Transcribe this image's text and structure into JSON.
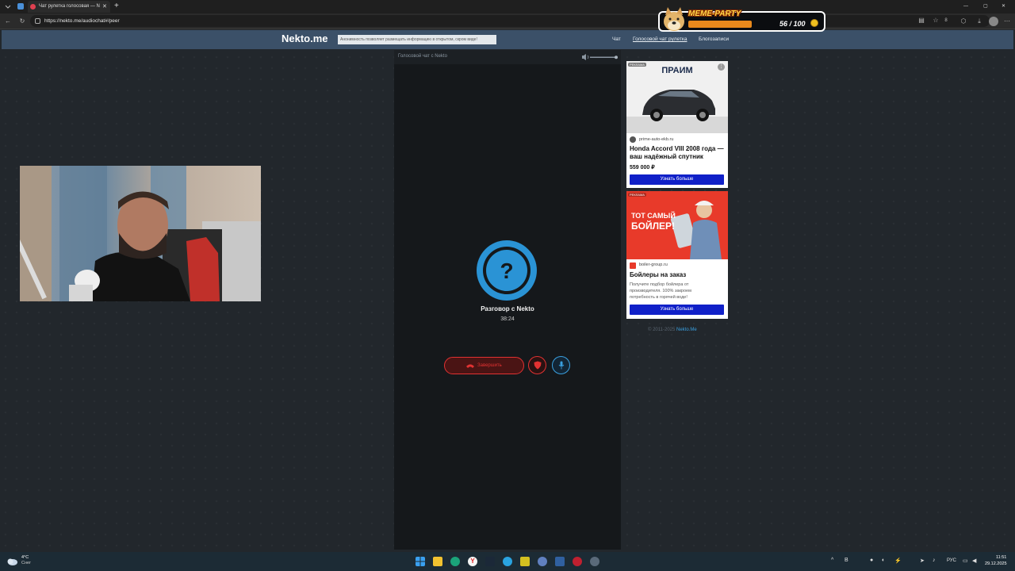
{
  "browser": {
    "tab_title": "Чат рулетка голосовая — N",
    "new_tab_glyph": "+",
    "url": "https://nekto.me/audiochat#/peer",
    "tab_count_badge": "8"
  },
  "site": {
    "logo": "Nekto.me",
    "notice": "Анонимность позволяет размещать информацию в открытом, скром виде!",
    "nav": {
      "chat": "Чат",
      "voice": "Голосовой чат рулетка",
      "blog": "Блогозаписи"
    }
  },
  "chat": {
    "header": "Голосовой чат с Nekto",
    "avatar_glyph": "?",
    "conversation": "Разговор с Nekto",
    "timer": "38:24",
    "end_button": "Завершить",
    "volume_level": 1.0
  },
  "ads": [
    {
      "badge": "РЕКЛАМА",
      "brand": "ПРАИМ",
      "domain": "prime-auto-ekb.ru",
      "title": "Honda Accord VIII 2008 года — ваш надёжный спутник",
      "price": "559 000 ₽",
      "button": "Узнать больше"
    },
    {
      "badge": "РЕКЛАМА",
      "banner_text": "ТОТ САМЫЙ БОЙЛЕР!",
      "domain": "boiler-group.ru",
      "title": "Бойлеры на заказ",
      "description": "Получите подбор бойлера от производителя. 100% закроем потребность в горячей воде!",
      "button": "Узнать больше"
    }
  ],
  "footer": {
    "text": "© 2011-2025",
    "link": "Nekto.Me"
  },
  "overlay": {
    "title": "MEME-PARTY",
    "score": "56 / 100"
  },
  "taskbar": {
    "weather_temp": "4°C",
    "weather_desc": "Снег",
    "lang": "РУС",
    "time": "11:51",
    "date": "29.12.2025",
    "tray_b": "B"
  }
}
